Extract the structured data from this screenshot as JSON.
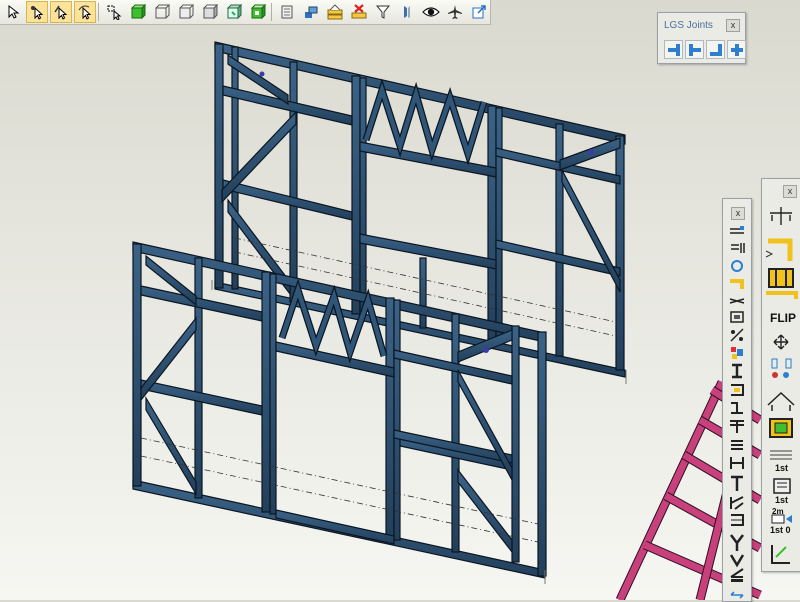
{
  "toolbar": {
    "tools": [
      {
        "name": "select-arrow-icon"
      },
      {
        "name": "select-point-icon",
        "selected": true
      },
      {
        "name": "select-node-icon",
        "selected": true
      },
      {
        "name": "select-edit-icon",
        "selected": true
      },
      {
        "name": "select-window-icon"
      },
      {
        "name": "solid-green-box-icon"
      },
      {
        "name": "wire-box-icon"
      },
      {
        "name": "hidden-box-icon"
      },
      {
        "name": "shaded-box-icon"
      },
      {
        "name": "textured-box-icon"
      },
      {
        "name": "box-view-icon"
      },
      {
        "name": "layer-icon"
      },
      {
        "name": "report-icon"
      },
      {
        "name": "stack-icon"
      },
      {
        "name": "folder-icon"
      },
      {
        "name": "delete-icon"
      },
      {
        "name": "filter-icon"
      },
      {
        "name": "profile-icon"
      },
      {
        "name": "eye-icon"
      },
      {
        "name": "airplane-icon"
      },
      {
        "name": "export-icon"
      }
    ]
  },
  "lgs_panel": {
    "title": "LGS Joints",
    "close_label": "x"
  },
  "left_panel": {
    "close_label": "x"
  },
  "right_panel": {
    "close_label": "x",
    "flip_label": "FLIP",
    "first_label_a": "1st",
    "first_label_b": "1st",
    "first_label_c": "1st 0",
    "dim_label": "2m"
  },
  "colors": {
    "steel": "#2f4f6e",
    "steel_edge": "#0b1621",
    "truss": "#c8407c",
    "accent": "#3f7fc4"
  }
}
